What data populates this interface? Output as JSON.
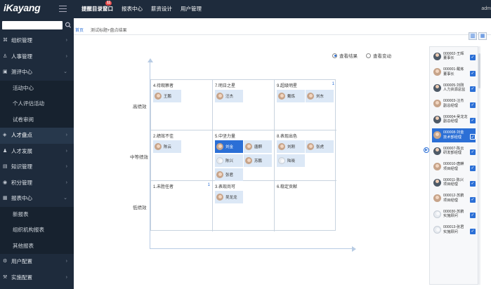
{
  "app": {
    "logo": "iKayang",
    "user": "adm"
  },
  "topnav": {
    "items": [
      {
        "label": "提醒目录窗口",
        "badge": "11"
      },
      {
        "label": "报表中心"
      },
      {
        "label": "薪资设计"
      },
      {
        "label": "用户管理"
      }
    ]
  },
  "sidebar": {
    "items": [
      {
        "label": "组织管理",
        "icon": "org-icon",
        "type": "group"
      },
      {
        "label": "人事管理",
        "icon": "person-icon",
        "type": "group"
      },
      {
        "label": "测评中心",
        "icon": "assess-icon",
        "type": "group-open"
      },
      {
        "label": "活动中心",
        "type": "sub"
      },
      {
        "label": "个人评估活动",
        "type": "sub"
      },
      {
        "label": "试卷审阅",
        "type": "sub"
      },
      {
        "label": "人才盘点",
        "icon": "talent-icon",
        "type": "group-selected"
      },
      {
        "label": "人才发展",
        "icon": "develop-icon",
        "type": "group"
      },
      {
        "label": "知识管理",
        "icon": "book-icon",
        "type": "group"
      },
      {
        "label": "积分管理",
        "icon": "points-icon",
        "type": "group"
      },
      {
        "label": "报表中心",
        "icon": "report-icon",
        "type": "group-open"
      },
      {
        "label": "新报表",
        "type": "sub"
      },
      {
        "label": "组织机构报表",
        "type": "sub"
      },
      {
        "label": "其他报表",
        "type": "sub"
      },
      {
        "label": "用户配置",
        "icon": "user-config-icon",
        "type": "group"
      },
      {
        "label": "实施配置",
        "icon": "impl-config-icon",
        "type": "group"
      }
    ]
  },
  "breadcrumb": {
    "home": "首页",
    "path": "测试标题+盘点结果"
  },
  "radios": {
    "result": "查看结果",
    "change": "查看变动",
    "selected": "result"
  },
  "axes": {
    "high": "高绩效",
    "mid": "中等绩效",
    "low": "低绩效"
  },
  "grid": [
    {
      "title": "4.待观察者",
      "count": "",
      "people": [
        {
          "name": "王鹏"
        }
      ]
    },
    {
      "title": "7.明日之星",
      "count": "",
      "people": [
        {
          "name": "汪杰"
        }
      ]
    },
    {
      "title": "9.超级明星",
      "count": "1",
      "people": [
        {
          "name": "戴炼"
        },
        {
          "name": "刘东"
        }
      ]
    },
    {
      "title": "2.绩效不佳",
      "count": "",
      "people": [
        {
          "name": "陈云"
        }
      ]
    },
    {
      "title": "5.中坚力量",
      "count": "",
      "people": [
        {
          "name": "刘金",
          "selected": true
        },
        {
          "name": "唐麒"
        },
        {
          "name": "陈兴"
        },
        {
          "name": "苏鹏"
        },
        {
          "name": "张君"
        }
      ]
    },
    {
      "title": "8.表现出色",
      "count": "",
      "people": [
        {
          "name": "刘刚"
        },
        {
          "name": "张虎"
        },
        {
          "name": "陆晓"
        }
      ]
    },
    {
      "title": "1.未胜任者",
      "count": "1",
      "people": []
    },
    {
      "title": "3.表现尚可",
      "count": "",
      "people": [
        {
          "name": "吴龙龙"
        }
      ]
    },
    {
      "title": "6.稳定贡献",
      "count": "",
      "people": []
    }
  ],
  "panel": [
    {
      "id": "000002-王辉",
      "role": "董事长"
    },
    {
      "id": "000001-戴炼",
      "role": "董事长"
    },
    {
      "id": "000005-刘刚",
      "role": "人力资源总监"
    },
    {
      "id": "000003-汪杰",
      "role": "副总经理"
    },
    {
      "id": "000004-吴龙龙",
      "role": "副总经理"
    },
    {
      "id": "000008-刘金",
      "role": "技术部经理",
      "selected": true
    },
    {
      "id": "000007-陈云",
      "role": "研发部经理"
    },
    {
      "id": "000010-唐麒",
      "role": "项目经理"
    },
    {
      "id": "000011-陈兴",
      "role": "项目经理"
    },
    {
      "id": "000012-苏鹏",
      "role": "项目经理"
    },
    {
      "id": "000030-苏鹏",
      "role": "实施顾问"
    },
    {
      "id": "000013-张君",
      "role": "实施顾问"
    }
  ]
}
